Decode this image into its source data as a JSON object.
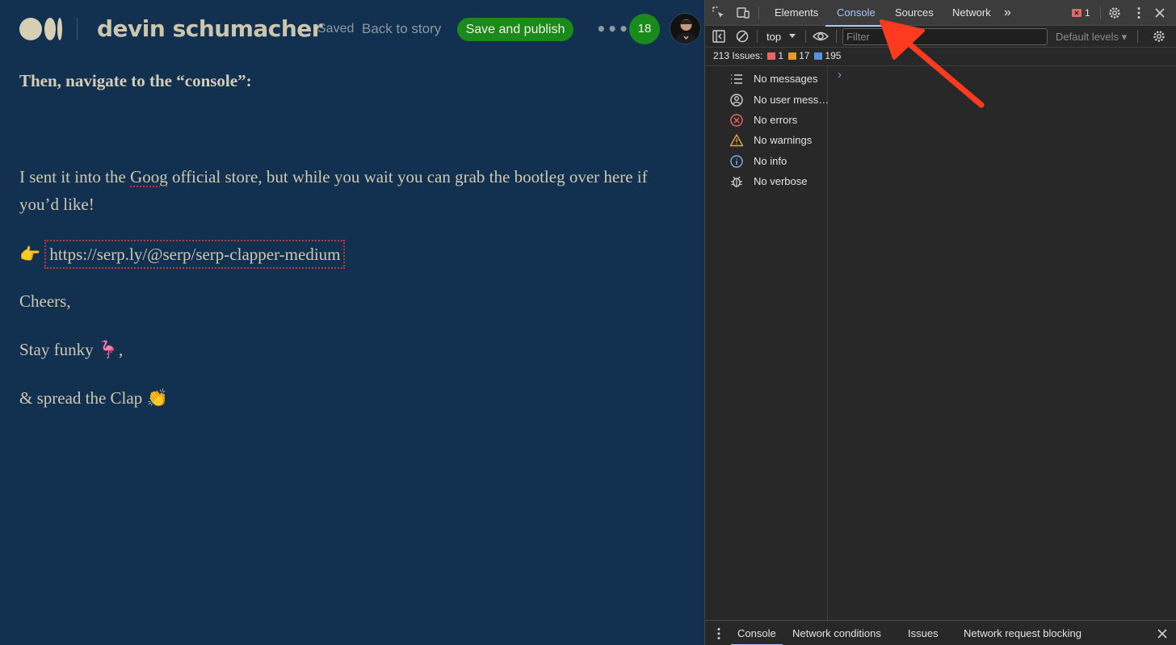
{
  "editor": {
    "author": "devin schumacher",
    "saved_label": "Saved",
    "back_label": "Back to story",
    "publish_label": "Save and publish",
    "more_label": "•••",
    "notifications_count": "18"
  },
  "article": {
    "heading": "Then, navigate to the “console”:",
    "p1_before": "I sent it into the ",
    "p1_goog": "Goog",
    "p1_after": " official store, but while you wait you can grab the bootleg over here if you’d like!",
    "link_emoji": "👉",
    "link_text": "https://serp.ly/@serp/serp-clapper-medium",
    "cheers": "Cheers,",
    "stay": "Stay funky 🦩,",
    "spread": "& spread the Clap 👏"
  },
  "devtools": {
    "tabs": [
      "Elements",
      "Console",
      "Sources",
      "Network"
    ],
    "more_tabs": "»",
    "error_badge_count": "1",
    "context_label": "top",
    "filter_placeholder": "Filter",
    "levels_label": "Default levels ▾",
    "issues": {
      "label": "213 Issues:",
      "errors": "1",
      "warnings": "17",
      "info": "195"
    },
    "sidebar": [
      {
        "label": "No messages",
        "icon": "list-icon"
      },
      {
        "label": "No user mess…",
        "icon": "user-icon"
      },
      {
        "label": "No errors",
        "icon": "error-icon"
      },
      {
        "label": "No warnings",
        "icon": "warning-icon"
      },
      {
        "label": "No info",
        "icon": "info-icon"
      },
      {
        "label": "No verbose",
        "icon": "bug-icon"
      }
    ],
    "prompt_symbol": "›",
    "drawer_tabs": [
      "Console",
      "Network conditions",
      "Issues",
      "Network request blocking"
    ]
  },
  "colors": {
    "editor_bg": "#12304f",
    "publish_green": "#1a8a1a",
    "devtools_bg": "#282828",
    "active_tab": "#a8c7fa",
    "arrow": "#ff3b1f"
  }
}
